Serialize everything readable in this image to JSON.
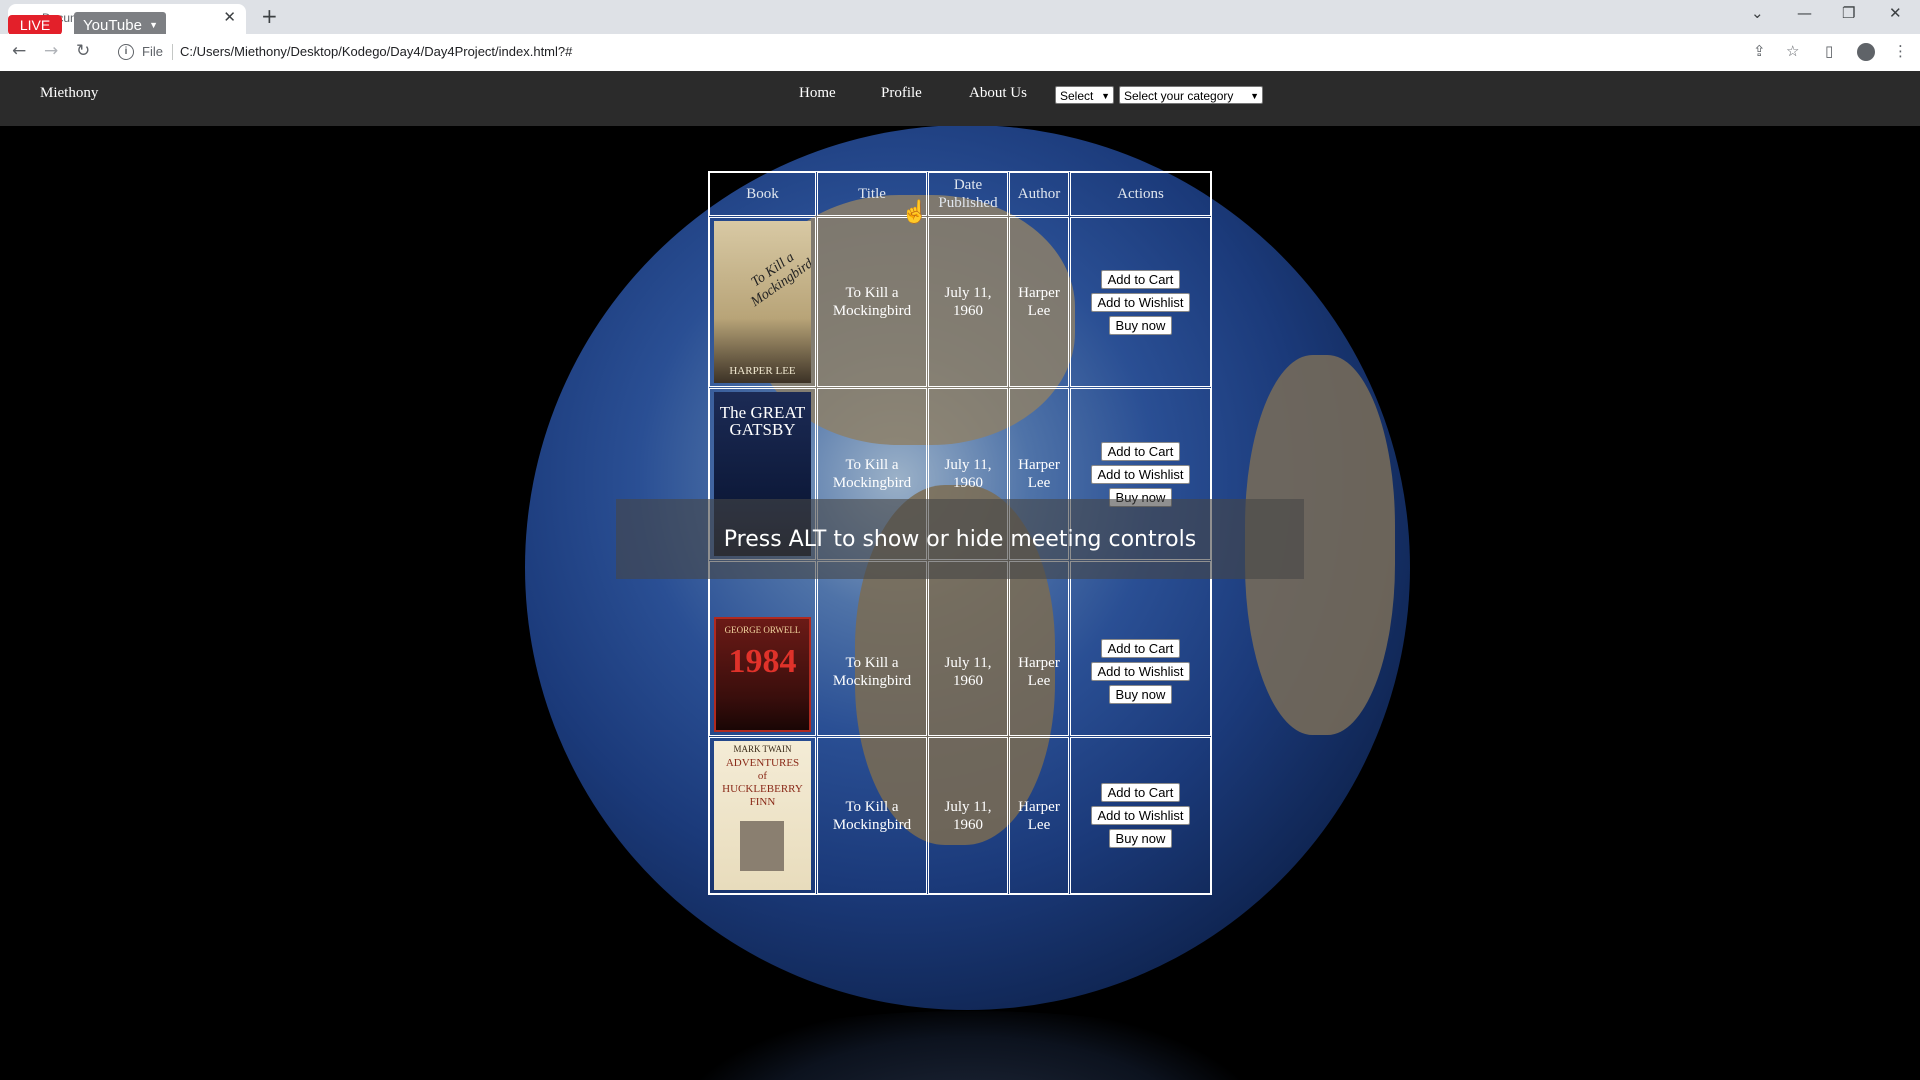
{
  "browser": {
    "live_badge": "LIVE",
    "tab_title": "Document",
    "youtube_label": "YouTube",
    "file_label": "File",
    "url": "C:/Users/Miethony/Desktop/Kodego/Day4/Day4Project/index.html?#"
  },
  "navbar": {
    "brand": "Miethony",
    "links": [
      "Home",
      "Profile",
      "About Us"
    ],
    "select1": "Select",
    "select2": "Select your category"
  },
  "table": {
    "headers": [
      "Book",
      "Title",
      "Date Published",
      "Author",
      "Actions"
    ],
    "rows": [
      {
        "cover": "To Kill a Mockingbird - Harper Lee",
        "cover_title": "To Kill a Mockingbird",
        "cover_author": "HARPER LEE",
        "title": "To Kill a Mockingbird",
        "date": "July 11, 1960",
        "author": "Harper Lee"
      },
      {
        "cover": "The Great Gatsby",
        "cover_title": "The GREAT GATSBY",
        "cover_author": "",
        "title": "To Kill a Mockingbird",
        "date": "July 11, 1960",
        "author": "Harper Lee"
      },
      {
        "cover": "1984 - George Orwell",
        "cover_title": "1984",
        "cover_author": "GEORGE ORWELL",
        "title": "To Kill a Mockingbird",
        "date": "July 11, 1960",
        "author": "Harper Lee"
      },
      {
        "cover": "Adventures of Huckleberry Finn - Mark Twain",
        "cover_title": "ADVENTURES of HUCKLEBERRY FINN",
        "cover_author": "MARK TWAIN",
        "title": "To Kill a Mockingbird",
        "date": "July 11, 1960",
        "author": "Harper Lee"
      }
    ],
    "buttons": {
      "cart": "Add to Cart",
      "wishlist": "Add to Wishlist",
      "buy": "Buy now"
    }
  },
  "overlay_text": "Press ALT to show or hide meeting controls"
}
